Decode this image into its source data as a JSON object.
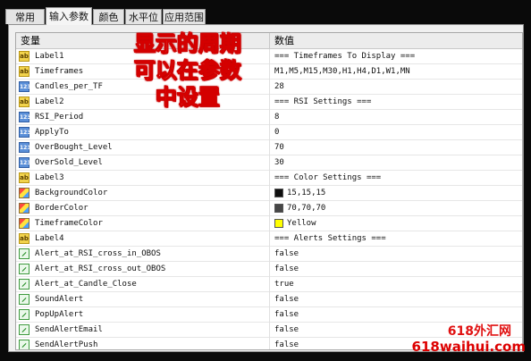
{
  "tabs": [
    "常用",
    "输入参数",
    "颜色",
    "水平位",
    "应用范围"
  ],
  "active_tab": 1,
  "grid": {
    "header": {
      "name": "变量",
      "value": "数值"
    },
    "rows": [
      {
        "icon": "ab",
        "name": "Label1",
        "value": "=== Timeframes To Display ==="
      },
      {
        "icon": "ab",
        "name": "Timeframes",
        "value": "M1,M5,M15,M30,H1,H4,D1,W1,MN"
      },
      {
        "icon": "123",
        "name": "Candles_per_TF",
        "value": "28"
      },
      {
        "icon": "ab",
        "name": "Label2",
        "value": "=== RSI Settings ==="
      },
      {
        "icon": "123",
        "name": "RSI_Period",
        "value": "8"
      },
      {
        "icon": "123",
        "name": "ApplyTo",
        "value": "0"
      },
      {
        "icon": "123",
        "name": "OverBought_Level",
        "value": "70"
      },
      {
        "icon": "123",
        "name": "OverSold_Level",
        "value": "30"
      },
      {
        "icon": "ab",
        "name": "Label3",
        "value": "=== Color Settings ==="
      },
      {
        "icon": "color",
        "name": "BackgroundColor",
        "value": "15,15,15",
        "swatch": "#0f0f0f"
      },
      {
        "icon": "color",
        "name": "BorderColor",
        "value": "70,70,70",
        "swatch": "#464646"
      },
      {
        "icon": "color",
        "name": "TimeframeColor",
        "value": "Yellow",
        "swatch": "#ffff00"
      },
      {
        "icon": "ab",
        "name": "Label4",
        "value": "=== Alerts Settings ==="
      },
      {
        "icon": "bool",
        "name": "Alert_at_RSI_cross_in_OBOS",
        "value": "false"
      },
      {
        "icon": "bool",
        "name": "Alert_at_RSI_cross_out_OBOS",
        "value": "false"
      },
      {
        "icon": "bool",
        "name": "Alert_at_Candle_Close",
        "value": "true"
      },
      {
        "icon": "bool",
        "name": "SoundAlert",
        "value": "false"
      },
      {
        "icon": "bool",
        "name": "PopUpAlert",
        "value": "false"
      },
      {
        "icon": "bool",
        "name": "SendAlertEmail",
        "value": "false"
      },
      {
        "icon": "bool",
        "name": "SendAlertPush",
        "value": "false"
      }
    ]
  },
  "annotation": [
    "显示的周期",
    "可以在参数",
    "中设置"
  ],
  "watermark": {
    "line1": "618外汇网",
    "line2": "618waihui.com"
  }
}
